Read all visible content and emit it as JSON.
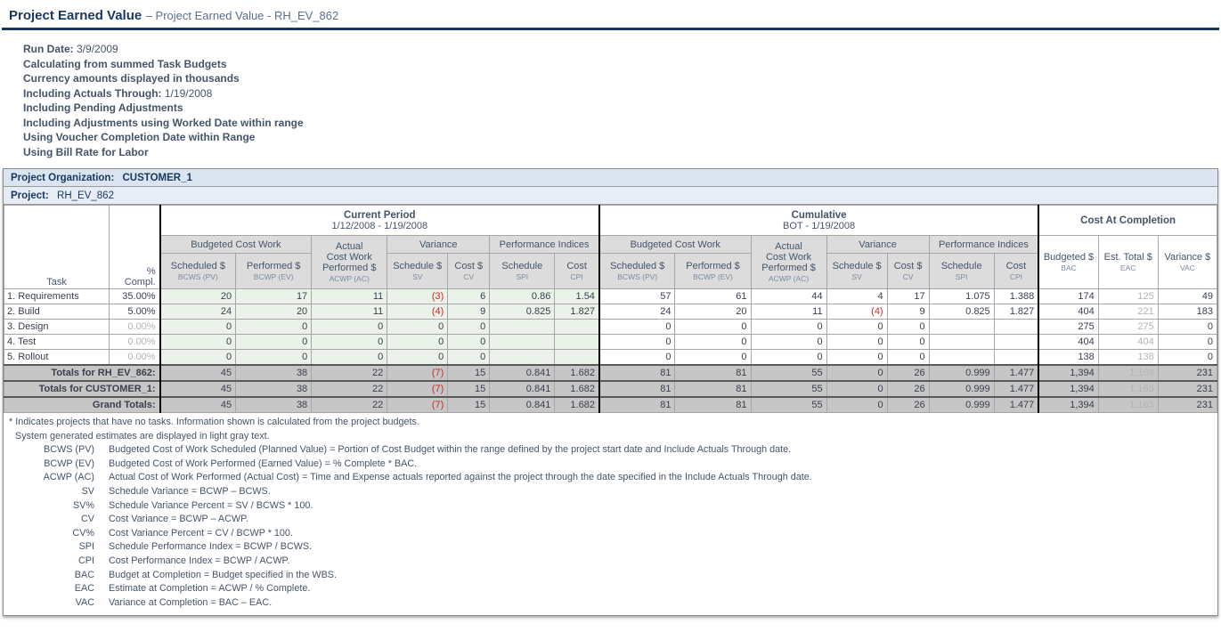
{
  "title": {
    "main": "Project Earned Value",
    "rest": "– Project Earned Value - RH_EV_862"
  },
  "info_lines": [
    {
      "label": "Run Date:",
      "value": " 3/9/2009"
    },
    {
      "label": "Calculating from summed Task Budgets",
      "value": ""
    },
    {
      "label": "Currency amounts displayed in thousands",
      "value": ""
    },
    {
      "label": "Including Actuals Through:",
      "value": " 1/19/2008"
    },
    {
      "label": "Including Pending Adjustments",
      "value": ""
    },
    {
      "label": "Including Adjustments using Worked Date within range",
      "value": ""
    },
    {
      "label": "Using Voucher Completion Date within Range",
      "value": ""
    },
    {
      "label": "Using Bill Rate for Labor",
      "value": ""
    }
  ],
  "org_bar": {
    "label": "Project Organization:",
    "value": "CUSTOMER_1"
  },
  "project_bar": {
    "label": "Project:",
    "value": "RH_EV_862"
  },
  "table": {
    "corner": {
      "task": "Task",
      "pct": "% Compl."
    },
    "sections": [
      {
        "title": "Current Period",
        "subtitle": "1/12/2008 - 1/19/2008"
      },
      {
        "title": "Cumulative",
        "subtitle": "BOT - 1/19/2008"
      },
      {
        "title": "Cost At Completion",
        "subtitle": ""
      }
    ],
    "groups": {
      "budgeted": "Budgeted Cost Work",
      "actual": "Actual\nCost Work\nPerformed $",
      "actual_sub": "ACWP (AC)",
      "variance": "Variance",
      "performance": "Performance Indices"
    },
    "cols": {
      "scheduled": {
        "label": "Scheduled $",
        "sub": "BCWS (PV)"
      },
      "performed": {
        "label": "Performed $",
        "sub": "BCWP (EV)"
      },
      "sched_var": {
        "label": "Schedule $",
        "sub": "SV"
      },
      "cost_var": {
        "label": "Cost $",
        "sub": "CV"
      },
      "spi": {
        "label": "Schedule",
        "sub": "SPI"
      },
      "cpi": {
        "label": "Cost",
        "sub": "CPI"
      },
      "bac": {
        "label": "Budgeted $",
        "sub": "BAC"
      },
      "eac": {
        "label": "Est. Total $",
        "sub": "EAC"
      },
      "vac": {
        "label": "Variance $",
        "sub": "VAC"
      }
    },
    "rows": [
      {
        "task": "1. Requirements",
        "pct": "35.00%",
        "gray_pct": false,
        "cp": [
          "20",
          "17",
          "11",
          "(3)",
          "6",
          "0.86",
          "1.54"
        ],
        "cum": [
          "57",
          "61",
          "44",
          "4",
          "17",
          "1.075",
          "1.388"
        ],
        "cac": [
          "174",
          "125",
          "49"
        ]
      },
      {
        "task": "2. Build",
        "pct": "5.00%",
        "gray_pct": false,
        "cp": [
          "24",
          "20",
          "11",
          "(4)",
          "9",
          "0.825",
          "1.827"
        ],
        "cum": [
          "24",
          "20",
          "11",
          "(4)",
          "9",
          "0.825",
          "1.827"
        ],
        "cac": [
          "404",
          "221",
          "183"
        ]
      },
      {
        "task": "3. Design",
        "pct": "0.00%",
        "gray_pct": true,
        "cp": [
          "0",
          "0",
          "0",
          "0",
          "0",
          "",
          ""
        ],
        "cum": [
          "0",
          "0",
          "0",
          "0",
          "0",
          "",
          ""
        ],
        "cac": [
          "275",
          "275",
          "0"
        ]
      },
      {
        "task": "4. Test",
        "pct": "0.00%",
        "gray_pct": true,
        "cp": [
          "0",
          "0",
          "0",
          "0",
          "0",
          "",
          ""
        ],
        "cum": [
          "0",
          "0",
          "0",
          "0",
          "0",
          "",
          ""
        ],
        "cac": [
          "404",
          "404",
          "0"
        ]
      },
      {
        "task": "5. Rollout",
        "pct": "0.00%",
        "gray_pct": true,
        "cp": [
          "0",
          "0",
          "0",
          "0",
          "0",
          "",
          ""
        ],
        "cum": [
          "0",
          "0",
          "0",
          "0",
          "0",
          "",
          ""
        ],
        "cac": [
          "138",
          "138",
          "0"
        ]
      }
    ],
    "total_rows": [
      {
        "label": "Totals for RH_EV_862:",
        "cp": [
          "45",
          "38",
          "22",
          "(7)",
          "15",
          "0.841",
          "1.682"
        ],
        "cum": [
          "81",
          "81",
          "55",
          "0",
          "26",
          "0.999",
          "1.477"
        ],
        "cac": [
          "1,394",
          "1,163",
          "231"
        ]
      },
      {
        "label": "Totals for CUSTOMER_1:",
        "cp": [
          "45",
          "38",
          "22",
          "(7)",
          "15",
          "0.841",
          "1.682"
        ],
        "cum": [
          "81",
          "81",
          "55",
          "0",
          "26",
          "0.999",
          "1.477"
        ],
        "cac": [
          "1,394",
          "1,163",
          "231"
        ]
      },
      {
        "label": "Grand Totals:",
        "cp": [
          "45",
          "38",
          "22",
          "(7)",
          "15",
          "0.841",
          "1.682"
        ],
        "cum": [
          "81",
          "81",
          "55",
          "0",
          "26",
          "0.999",
          "1.477"
        ],
        "cac": [
          "1,394",
          "1,163",
          "231"
        ]
      }
    ]
  },
  "footnotes": {
    "notes": [
      "* Indicates projects that have no tasks. Information shown is calculated from the project budgets.",
      "System generated estimates are displayed in light gray text."
    ],
    "defs": [
      {
        "term": "BCWS (PV)",
        "text": "Budgeted Cost of Work Scheduled (Planned Value) = Portion of Cost Budget within the range defined by the project start date and Include Actuals Through date."
      },
      {
        "term": "BCWP (EV)",
        "text": "Budgeted Cost of Work Performed (Earned Value) = % Complete * BAC."
      },
      {
        "term": "ACWP (AC)",
        "text": "Actual Cost of Work Performed (Actual Cost) = Time and Expense actuals reported against the project through the date specified in the Include Actuals Through date."
      },
      {
        "term": "SV",
        "text": "Schedule Variance = BCWP – BCWS."
      },
      {
        "term": "SV%",
        "text": "Schedule Variance Percent = SV / BCWS * 100."
      },
      {
        "term": "CV",
        "text": "Cost Variance = BCWP – ACWP."
      },
      {
        "term": "CV%",
        "text": "Cost Variance Percent = CV / BCWP * 100."
      },
      {
        "term": "SPI",
        "text": "Schedule Performance Index = BCWP / BCWS."
      },
      {
        "term": "CPI",
        "text": "Cost Performance Index = BCWP / ACWP."
      },
      {
        "term": "BAC",
        "text": "Budget at Completion = Budget specified in the WBS."
      },
      {
        "term": "EAC",
        "text": "Estimate at Completion = ACWP / % Complete."
      },
      {
        "term": "VAC",
        "text": "Variance at Completion = BAC – EAC."
      }
    ]
  },
  "colors": {
    "title_navy": "#17375E",
    "slate_text": "#44546A",
    "bar_blue": "#DBE5F1",
    "current_period_green": "#EAF2E9",
    "header_gray": "#DCDCDC",
    "totals_gray": "#C6C6C6",
    "negative_red": "#C92A21",
    "estimate_gray": "#B3B3B3"
  }
}
